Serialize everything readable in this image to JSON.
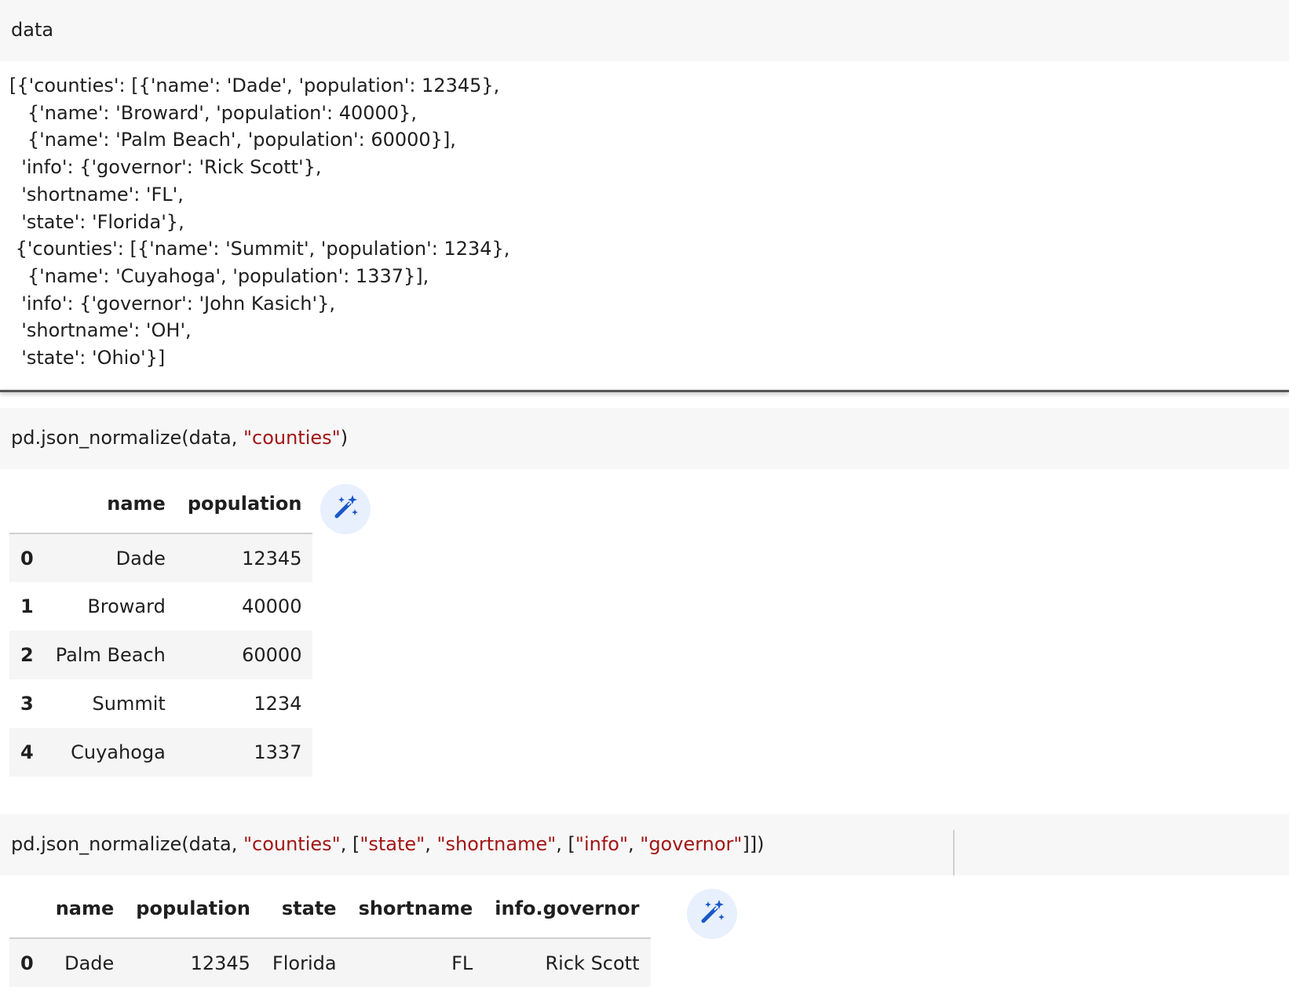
{
  "cell1": {
    "code": "data",
    "output_lines": [
      "[{'counties': [{'name': 'Dade', 'population': 12345},",
      "   {'name': 'Broward', 'population': 40000},",
      "   {'name': 'Palm Beach', 'population': 60000}],",
      "  'info': {'governor': 'Rick Scott'},",
      "  'shortname': 'FL',",
      "  'state': 'Florida'},",
      " {'counties': [{'name': 'Summit', 'population': 1234},",
      "   {'name': 'Cuyahoga', 'population': 1337}],",
      "  'info': {'governor': 'John Kasich'},",
      "  'shortname': 'OH',",
      "  'state': 'Ohio'}]"
    ]
  },
  "cell2": {
    "code_prefix": "pd.json_normalize(data, ",
    "code_arg": "\"counties\"",
    "code_suffix": ")",
    "table": {
      "columns": [
        "name",
        "population"
      ],
      "index": [
        "0",
        "1",
        "2",
        "3",
        "4"
      ],
      "rows": [
        [
          "Dade",
          "12345"
        ],
        [
          "Broward",
          "40000"
        ],
        [
          "Palm Beach",
          "60000"
        ],
        [
          "Summit",
          "1234"
        ],
        [
          "Cuyahoga",
          "1337"
        ]
      ]
    }
  },
  "cell3": {
    "code_parts": [
      {
        "text": "pd.json_normalize(data, ",
        "type": "plain"
      },
      {
        "text": "\"counties\"",
        "type": "string"
      },
      {
        "text": ", [",
        "type": "plain"
      },
      {
        "text": "\"state\"",
        "type": "string"
      },
      {
        "text": ", ",
        "type": "plain"
      },
      {
        "text": "\"shortname\"",
        "type": "string"
      },
      {
        "text": ", [",
        "type": "plain"
      },
      {
        "text": "\"info\"",
        "type": "string"
      },
      {
        "text": ", ",
        "type": "plain"
      },
      {
        "text": "\"governor\"",
        "type": "string"
      },
      {
        "text": "]])",
        "type": "plain"
      }
    ],
    "table": {
      "columns": [
        "name",
        "population",
        "state",
        "shortname",
        "info.governor"
      ],
      "index": [
        "0"
      ],
      "rows": [
        [
          "Dade",
          "12345",
          "Florida",
          "FL",
          "Rick Scott"
        ]
      ]
    }
  },
  "icons": {
    "magic": "magic-wand-icon"
  },
  "colors": {
    "string": "#a31515",
    "magic_bg": "#e8f0fe",
    "magic_fg": "#1a57c9"
  }
}
